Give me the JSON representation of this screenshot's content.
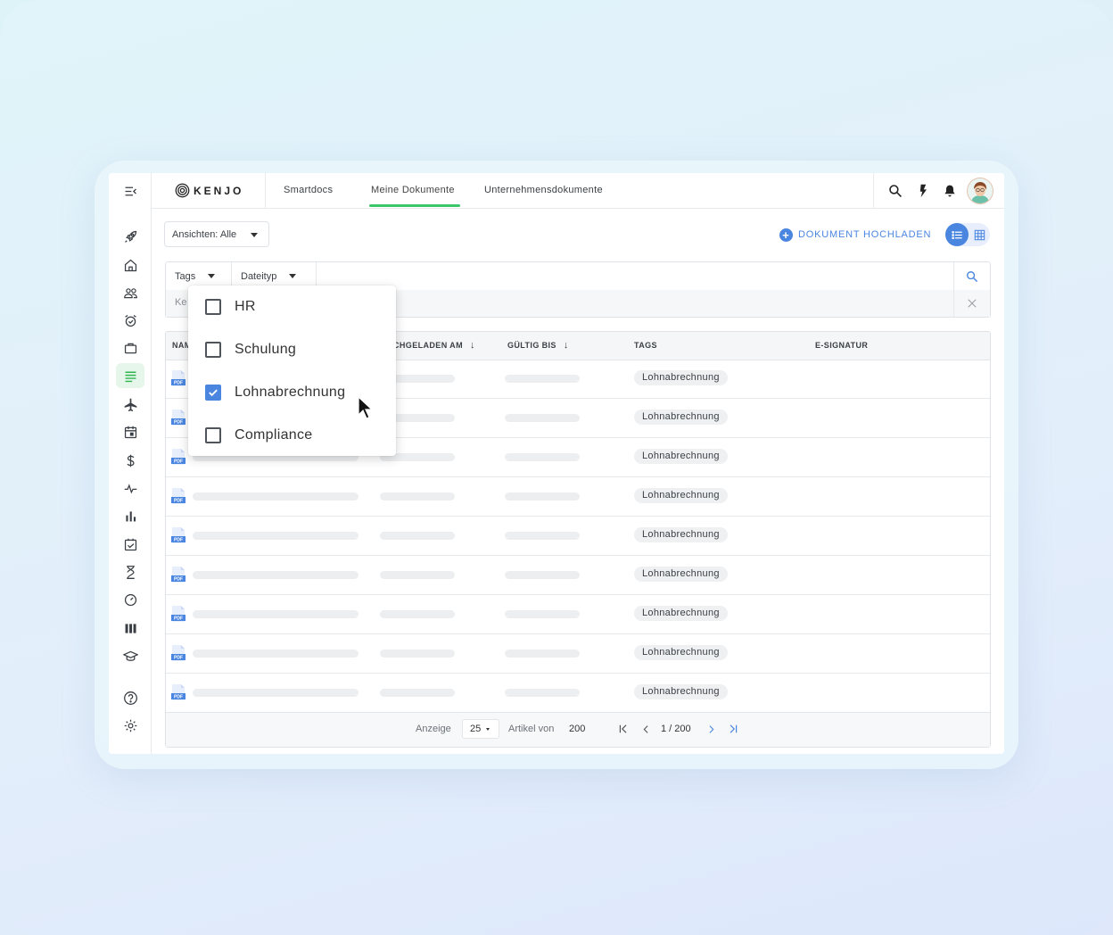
{
  "app": {
    "brand": "KENJO"
  },
  "tabs": [
    {
      "label": "Smartdocs"
    },
    {
      "label": "Meine Dokumente",
      "active": true
    },
    {
      "label": "Unternehmensdokumente"
    }
  ],
  "toolbar": {
    "views_label": "Ansichten: Alle",
    "upload_label": "DOKUMENT HOCHLADEN"
  },
  "filters": {
    "tags_label": "Tags",
    "filetype_label": "Dateityp",
    "keyword_placeholder": "Ke"
  },
  "tag_dropdown": {
    "options": [
      {
        "label": "HR",
        "checked": false
      },
      {
        "label": "Schulung",
        "checked": false
      },
      {
        "label": "Lohnabrechnung",
        "checked": true
      },
      {
        "label": "Compliance",
        "checked": false
      }
    ]
  },
  "table": {
    "headers": {
      "name": "NAM",
      "uploaded": "CHGELADEN AM",
      "valid_until": "GÜLTIG BIS",
      "tags": "TAGS",
      "esign": "E-SIGNATUR"
    },
    "file_badge": "PDF",
    "rows": [
      {
        "tag": "Lohnabrechnung"
      },
      {
        "tag": "Lohnabrechnung"
      },
      {
        "tag": "Lohnabrechnung"
      },
      {
        "tag": "Lohnabrechnung"
      },
      {
        "tag": "Lohnabrechnung"
      },
      {
        "tag": "Lohnabrechnung"
      },
      {
        "tag": "Lohnabrechnung"
      },
      {
        "tag": "Lohnabrechnung"
      },
      {
        "tag": "Lohnabrechnung"
      }
    ]
  },
  "pagination": {
    "display_label": "Anzeige",
    "page_size": "25",
    "items_of_label": "Artikel von",
    "total": "200",
    "page_indicator": "1 / 200"
  },
  "colors": {
    "accent_blue": "#4a86e0",
    "accent_green": "#3cc66a"
  },
  "sidebar_icons": [
    "menu-collapse-icon",
    "rocket-icon",
    "home-icon",
    "people-icon",
    "alarm-icon",
    "briefcase-icon",
    "documents-icon",
    "plane-icon",
    "calendar-icon",
    "dollar-icon",
    "pulse-icon",
    "bar-chart-icon",
    "checklist-icon",
    "hourglass-icon",
    "gauge-icon",
    "columns-icon",
    "graduation-cap-icon",
    "help-icon",
    "gear-icon"
  ]
}
